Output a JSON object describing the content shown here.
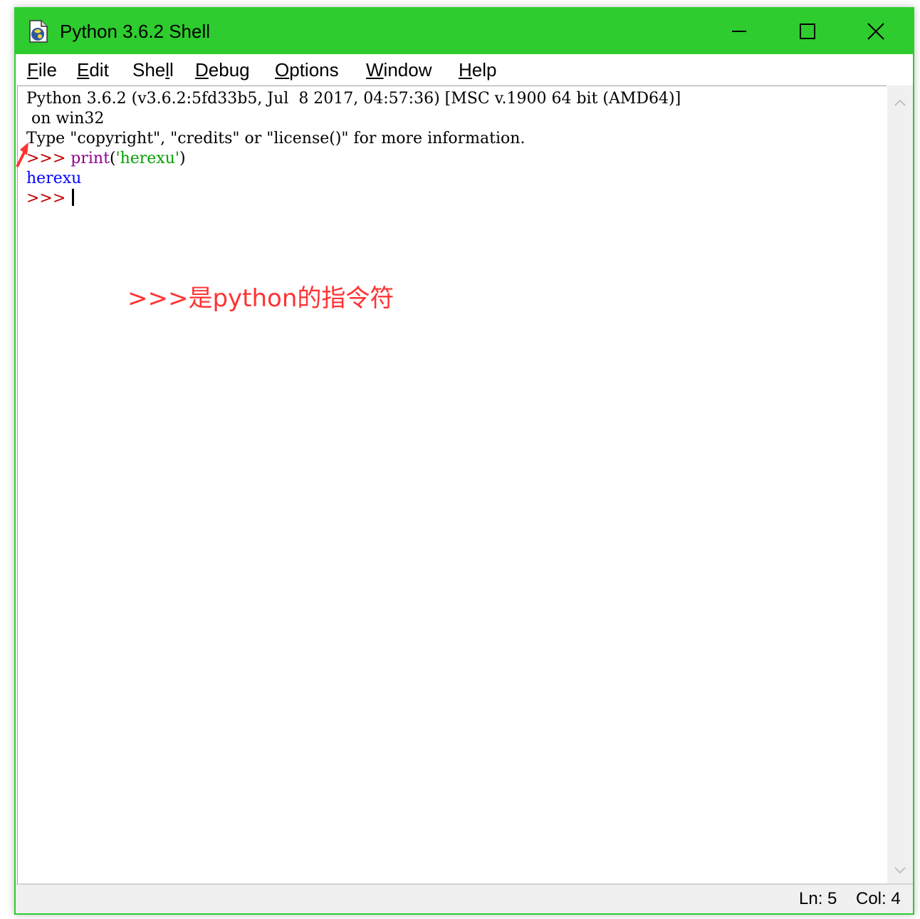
{
  "window": {
    "title": "Python 3.6.2 Shell",
    "accent_color": "#2ecc2e",
    "icons": {
      "app": "python-idle-icon",
      "minimize": "minimize-icon",
      "maximize": "maximize-icon",
      "close": "close-icon"
    }
  },
  "menu": {
    "items": [
      {
        "label": "File",
        "mnemonic": "F",
        "rest": "ile"
      },
      {
        "label": "Edit",
        "mnemonic": "E",
        "rest": "dit"
      },
      {
        "label": "Shell",
        "mnemonic": "l",
        "pre": "She",
        "rest": "l"
      },
      {
        "label": "Debug",
        "mnemonic": "D",
        "rest": "ebug"
      },
      {
        "label": "Options",
        "mnemonic": "O",
        "rest": "ptions"
      },
      {
        "label": "Window",
        "mnemonic": "W",
        "rest": "indow"
      },
      {
        "label": "Help",
        "mnemonic": "H",
        "rest": "elp"
      }
    ]
  },
  "shell": {
    "banner_line1": "Python 3.6.2 (v3.6.2:5fd33b5, Jul  8 2017, 04:57:36) [MSC v.1900 64 bit (AMD64)]",
    "banner_line2": " on win32",
    "banner_line3": "Type \"copyright\", \"credits\" or \"license()\" for more information.",
    "prompt": ">>> ",
    "cmd_builtin": "print",
    "cmd_open": "(",
    "cmd_string": "'herexu'",
    "cmd_close": ")",
    "output": "herexu",
    "prompt2": ">>> ",
    "colors": {
      "prompt": "#c00000",
      "builtin": "#900090",
      "string": "#00a000",
      "output": "#0000ff"
    }
  },
  "annotation": {
    "text": ">>>是python的指令符",
    "color": "#ff3333"
  },
  "status": {
    "ln": "Ln: 5",
    "col": "Col: 4"
  }
}
